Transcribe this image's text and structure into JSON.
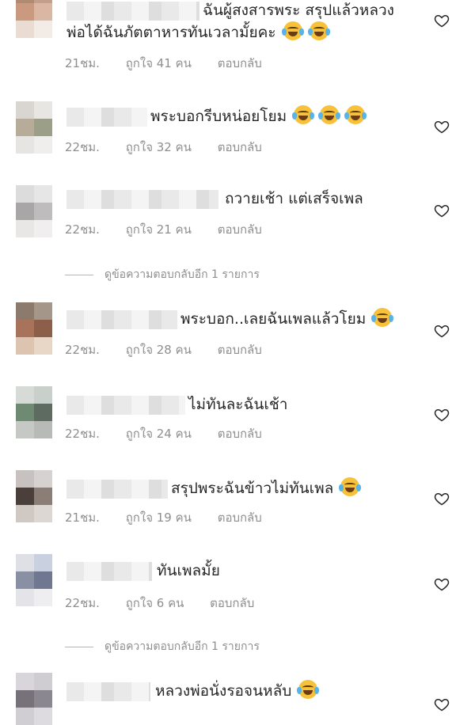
{
  "comments": [
    {
      "text_lines": [
        "ฉันผู้สงสารพระ สรุปแล้วหลวง",
        "พ่อได้ฉันภัตตาหารทันเวลามั้ยคะ"
      ],
      "time": "21ชม.",
      "likes": "ถูกใจ 41 คน",
      "reply": "ตอบกลับ",
      "emoji_count": 2
    },
    {
      "text_lines": [
        "พระบอกรีบหน่อยโยม"
      ],
      "time": "22ชม.",
      "likes": "ถูกใจ 32 คน",
      "reply": "ตอบกลับ",
      "emoji_count": 3
    },
    {
      "text_lines": [
        "ถวายเช้า แต่เสร็จเพล"
      ],
      "time": "22ชม.",
      "likes": "ถูกใจ 21 คน",
      "reply": "ตอบกลับ",
      "emoji_count": 0
    },
    {
      "text_lines": [
        "พระบอก..เลยฉันเพลแล้วโยม"
      ],
      "time": "22ชม.",
      "likes": "ถูกใจ 28 คน",
      "reply": "ตอบกลับ",
      "emoji_count": 1
    },
    {
      "text_lines": [
        "ไม่ทันละฉันเช้า"
      ],
      "time": "22ชม.",
      "likes": "ถูกใจ 24 คน",
      "reply": "ตอบกลับ",
      "emoji_count": 0
    },
    {
      "text_lines": [
        "สรุปพระฉันข้าวไม่ทันเพล"
      ],
      "time": "21ชม.",
      "likes": "ถูกใจ 19 คน",
      "reply": "ตอบกลับ",
      "emoji_count": 1
    },
    {
      "text_lines": [
        "ทันเพลมั้ย"
      ],
      "time": "22ชม.",
      "likes": "ถูกใจ 6 คน",
      "reply": "ตอบกลับ",
      "emoji_count": 0
    },
    {
      "text_lines": [
        "หลวงพ่อนั่งรอจนหลับ"
      ],
      "emoji_count": 1
    }
  ],
  "view_replies": [
    {
      "label": "ดูข้อความตอบกลับอีก 1 รายการ"
    },
    {
      "label": "ดูข้อความตอบกลับอีก 1 รายการ"
    }
  ],
  "icons": {
    "like": "heart-outline-icon",
    "emoji": "face-with-tears-of-joy"
  },
  "colors": {
    "text": "#262626",
    "meta": "#8e8e8e",
    "background": "#ffffff"
  }
}
